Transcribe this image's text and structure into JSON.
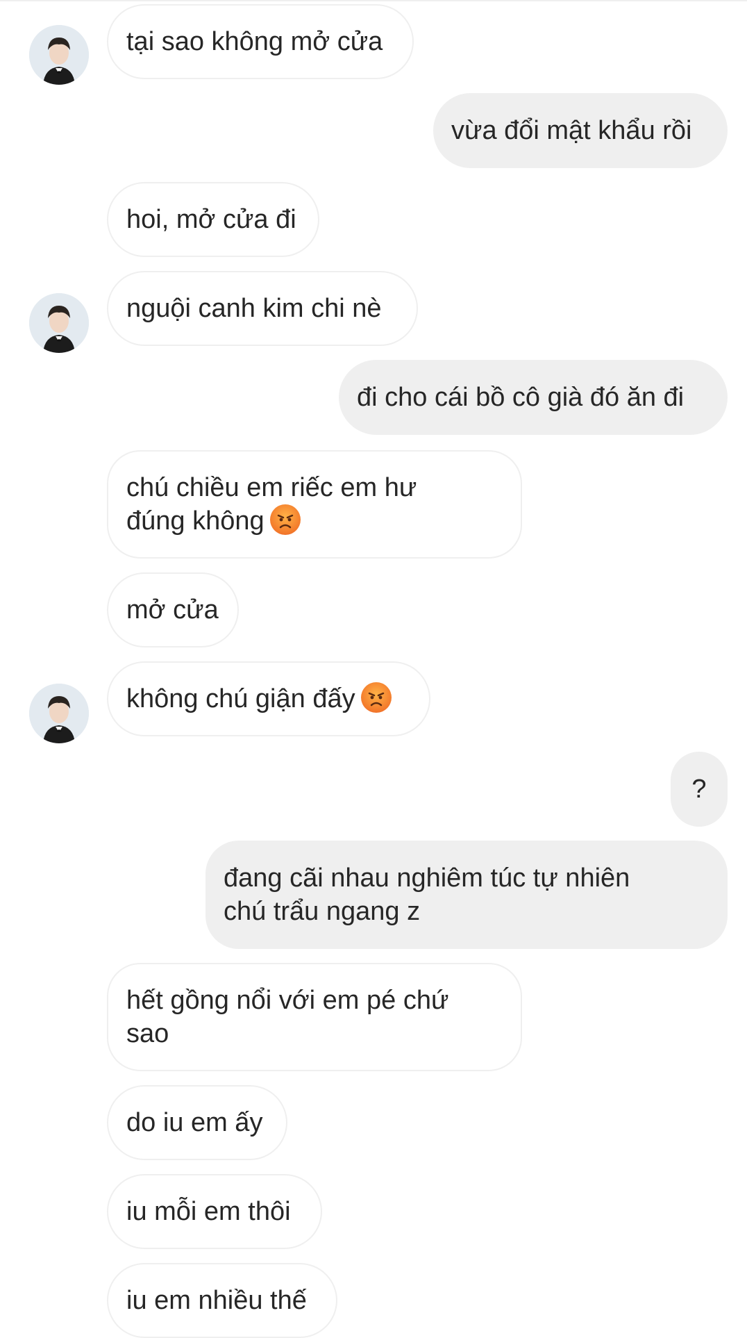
{
  "thread": {
    "messages": [
      {
        "side": "in",
        "text": "tại sao không mở cửa"
      },
      {
        "side": "out",
        "text": "vừa đổi mật khẩu rồi"
      },
      {
        "side": "in",
        "text": "hoi, mở cửa đi"
      },
      {
        "side": "in",
        "text": "nguội canh kim chi nè"
      },
      {
        "side": "out",
        "text": "đi cho cái bồ cô già đó ăn đi"
      },
      {
        "side": "in",
        "text": "chú chiều em riếc em hư\nđúng không",
        "emoji": "angry-face-emoji"
      },
      {
        "side": "in",
        "text": "mở cửa"
      },
      {
        "side": "in",
        "text": "không chú giận đấy",
        "emoji": "angry-face-emoji"
      },
      {
        "side": "out",
        "text": "?"
      },
      {
        "side": "out",
        "text": "đang cãi nhau nghiêm túc tự nhiên\nchú trẩu ngang z"
      },
      {
        "side": "in",
        "text": "hết gồng nổi với em pé chứ\nsao"
      },
      {
        "side": "in",
        "text": "do iu em ấy"
      },
      {
        "side": "in",
        "text": "iu mỗi em thôi"
      },
      {
        "side": "in",
        "text": "iu em nhiều thế"
      }
    ]
  },
  "colors": {
    "outgoing_bubble": "#efefef",
    "incoming_border": "#efefef",
    "text": "#262626",
    "emoji": "#f3792b"
  },
  "icons": {
    "avatar": "contact-avatar",
    "emoji": "angry-face-emoji"
  }
}
